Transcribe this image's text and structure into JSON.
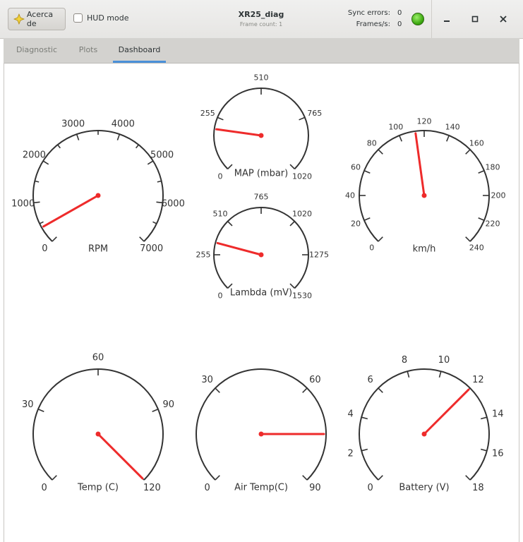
{
  "titlebar": {
    "about_label": "Acerca de",
    "hud_label": "HUD mode",
    "title": "XR25_diag",
    "subtitle": "Frame count: 1",
    "sync_errors_label": "Sync errors:",
    "sync_errors_value": "0",
    "frames_label": "Frames/s:",
    "frames_value": "0",
    "status_color": "#3aa60e"
  },
  "tabs": [
    {
      "label": "Diagnostic",
      "active": false
    },
    {
      "label": "Plots",
      "active": false
    },
    {
      "label": "Dashboard",
      "active": true
    }
  ],
  "gauges": [
    {
      "name": "rpm",
      "label": "RPM",
      "ticks": [
        "0",
        "1000",
        "2000",
        "3000",
        "4000",
        "5000",
        "6000",
        "7000"
      ],
      "min": 0,
      "max": 7000,
      "value": 400,
      "minor": true
    },
    {
      "name": "map",
      "label": "MAP (mbar)",
      "ticks": [
        "0",
        "255",
        "510",
        "765",
        "1020"
      ],
      "min": 0,
      "max": 1020,
      "value": 200,
      "minor": false
    },
    {
      "name": "speed",
      "label": "km/h",
      "ticks": [
        "0",
        "20",
        "40",
        "60",
        "80",
        "100",
        "120",
        "140",
        "160",
        "180",
        "200",
        "220",
        "240"
      ],
      "min": 0,
      "max": 240,
      "value": 113,
      "minor": false
    },
    {
      "name": "lambda",
      "label": "Lambda (mV)",
      "ticks": [
        "0",
        "255",
        "510",
        "765",
        "1020",
        "1275",
        "1530"
      ],
      "min": 0,
      "max": 1530,
      "value": 340,
      "minor": false
    },
    {
      "name": "temp",
      "label": "Temp (C)",
      "ticks": [
        "0",
        "30",
        "60",
        "90",
        "120"
      ],
      "min": 0,
      "max": 120,
      "value": 120,
      "minor": false
    },
    {
      "name": "airtemp",
      "label": "Air Temp(C)",
      "ticks": [
        "0",
        "30",
        "60",
        "90"
      ],
      "min": 0,
      "max": 90,
      "value": 75,
      "minor": false
    },
    {
      "name": "battery",
      "label": "Battery (V)",
      "ticks": [
        "0",
        "2",
        "4",
        "6",
        "8",
        "10",
        "12",
        "14",
        "16",
        "18"
      ],
      "min": 0,
      "max": 18,
      "value": 12,
      "minor": false
    }
  ],
  "colors": {
    "needle": "#ee2b2b",
    "dial": "#333333"
  }
}
